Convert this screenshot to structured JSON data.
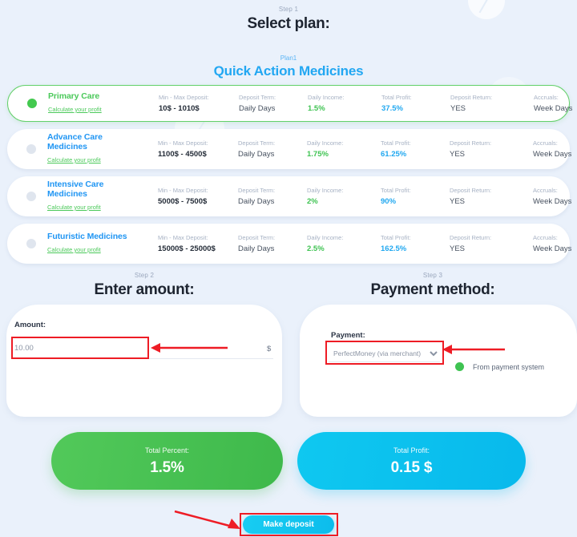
{
  "steps": {
    "step1": {
      "kicker": "Step 1",
      "title": "Select plan:"
    },
    "step2": {
      "kicker": "Step 2",
      "title": "Enter amount:"
    },
    "step3": {
      "kicker": "Step 3",
      "title": "Payment method:"
    }
  },
  "plan_group": {
    "kicker": "Plan1",
    "title": "Quick Action Medicines"
  },
  "columns": {
    "deposit": "Min - Max Deposit:",
    "term": "Deposit Term:",
    "income": "Daily Income:",
    "profit": "Total Profit:",
    "return": "Deposit Return:",
    "accruals": "Accruals:"
  },
  "calc_link": "Calculate your profit",
  "plans": [
    {
      "name": "Primary Care",
      "deposit": "10$ - 1010$",
      "term": "Daily Days",
      "income": "1.5%",
      "profit": "37.5%",
      "return": "YES",
      "accruals": "Week Days",
      "selected": true
    },
    {
      "name": "Advance Care Medicines",
      "deposit": "1100$ - 4500$",
      "term": "Daily Days",
      "income": "1.75%",
      "profit": "61.25%",
      "return": "YES",
      "accruals": "Week Days",
      "selected": false
    },
    {
      "name": "Intensive Care Medicines",
      "deposit": "5000$ - 7500$",
      "term": "Daily Days",
      "income": "2%",
      "profit": "90%",
      "return": "YES",
      "accruals": "Week Days",
      "selected": false
    },
    {
      "name": "Futuristic Medicines",
      "deposit": "15000$ - 25000$",
      "term": "Daily Days",
      "income": "2.5%",
      "profit": "162.5%",
      "return": "YES",
      "accruals": "Week Days",
      "selected": false
    }
  ],
  "amount": {
    "label": "Amount:",
    "value": "10.00",
    "placeholder": "10.00",
    "currency": "$"
  },
  "payment": {
    "label": "Payment:",
    "selected": "PerfectMoney (via merchant)",
    "options": [
      "PerfectMoney (via merchant)"
    ],
    "note": "From payment system",
    "note_dot_color": "#3fc352"
  },
  "results": {
    "percent": {
      "caption": "Total Percent:",
      "value": "1.5%",
      "color": "#43c253"
    },
    "profit": {
      "caption": "Total Profit:",
      "value": "0.15 $",
      "color": "#0cc2ef"
    }
  },
  "deposit_button": {
    "label": "Make deposit"
  },
  "annotation_color": "#ee1c25"
}
